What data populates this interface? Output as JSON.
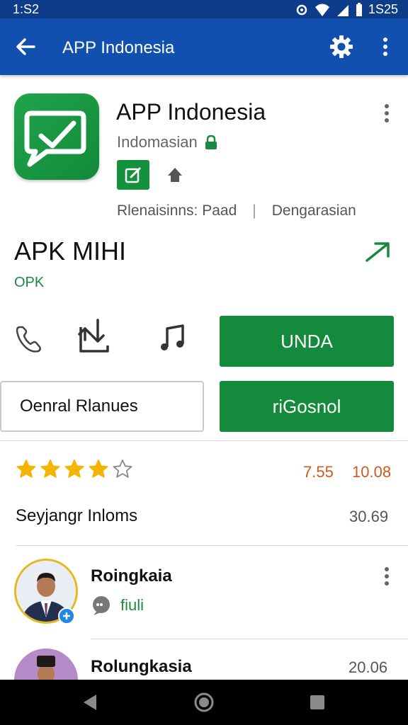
{
  "status_bar": {
    "time": "1:S2",
    "clock": "1S25",
    "icons": [
      "settings-icon",
      "wifi-icon",
      "signal-icon",
      "battery-icon"
    ]
  },
  "app_bar": {
    "title": "APP Indonesia",
    "icons": [
      "back-arrow-icon",
      "settings-icon",
      "more-vert-icon"
    ]
  },
  "app_header": {
    "name": "APP Indonesia",
    "developer": "Indomasian",
    "meta_left": "Rlenaisinns: Paad",
    "meta_right": "Dengarasian",
    "icons": [
      "chat-check-icon",
      "lock-icon",
      "edit-icon",
      "home-icon",
      "more-vert-icon"
    ]
  },
  "section": {
    "title": "APK MIHI",
    "subtitle": "OPK",
    "icons": [
      "arrow-right-icon"
    ]
  },
  "actions": {
    "primary_label": "UNDA",
    "outline_label": "Oenral Rlanues",
    "secondary_label": "riGosnol",
    "icons": [
      "phone-icon",
      "share-icon",
      "music-icon"
    ]
  },
  "ratings": {
    "stars_filled": 4,
    "stars_total": 5,
    "value_a": "7.55",
    "value_b": "10.08"
  },
  "info": {
    "label": "Seyjangr Inloms",
    "value": "30.69"
  },
  "reviews": [
    {
      "name": "Roingkaia",
      "meta_text": "fiuli"
    },
    {
      "name": "Rolungkasia",
      "value": "20.06"
    }
  ],
  "colors": {
    "app_bar": "#1250b0",
    "status_bar": "#0d3c8a",
    "accent_green": "#138a3c",
    "star": "#f5b400",
    "rating_text": "#d0581e"
  }
}
